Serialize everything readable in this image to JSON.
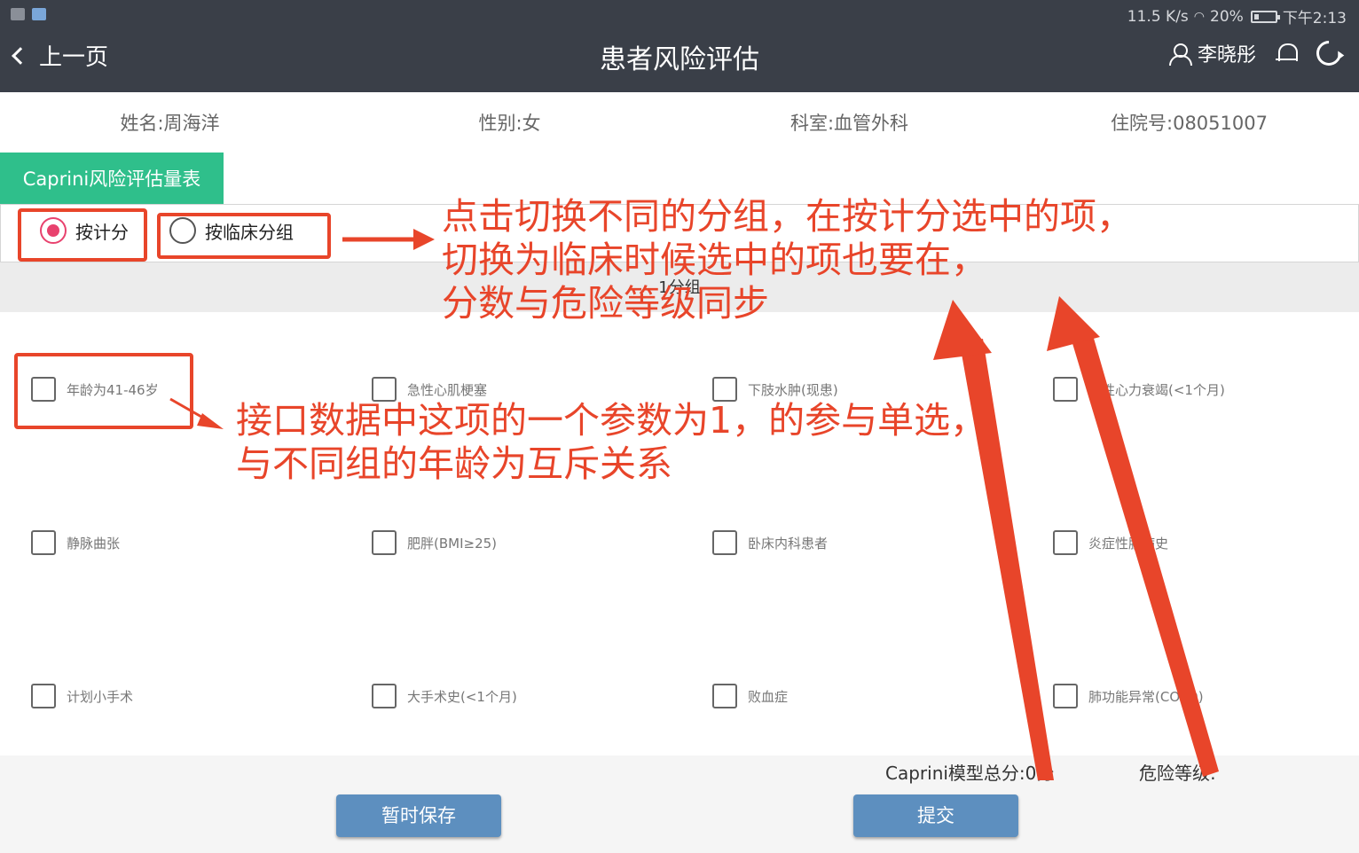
{
  "statusbar": {
    "speed": "11.5 K/s",
    "battery": "20%",
    "time": "下午2:13"
  },
  "nav": {
    "back_label": "上一页",
    "title": "患者风险评估",
    "user_name": "李晓彤"
  },
  "patient": {
    "name": "姓名:周海洋",
    "gender": "性别:女",
    "department": "科室:血管外科",
    "admission": "住院号:08051007"
  },
  "tab": {
    "label": "Caprini风险评估量表"
  },
  "mode": {
    "options": [
      {
        "label": "按计分",
        "selected": true
      },
      {
        "label": "按临床分组",
        "selected": false
      }
    ]
  },
  "group": {
    "title": "1分组"
  },
  "items": [
    "年龄为41-46岁",
    "急性心肌梗塞",
    "下肢水肿(现患)",
    "血性心力衰竭(<1个月)",
    "静脉曲张",
    "肥胖(BMI≥25)",
    "卧床内科患者",
    "炎症性肠病史",
    "计划小手术",
    "大手术史(<1个月)",
    "败血症",
    "肺功能异常(COPD)"
  ],
  "footer": {
    "total_score": "Caprini模型总分:0分",
    "risk_level": "危险等级:",
    "save_label": "暂时保存",
    "submit_label": "提交"
  },
  "annotations": {
    "top_note": "点击切换不同的分组，在按计分选中的项，\n切换为临床时候选中的项也要在，\n分数与危险等级同步",
    "item_note": "接口数据中这项的一个参数为1，的参与单选，\n与不同组的年龄为互斥关系"
  },
  "colors": {
    "accent_red": "#e8452a",
    "tab_green": "#2fbf8b",
    "button_blue": "#5d8fbf",
    "header_dark": "#3a3f48"
  }
}
